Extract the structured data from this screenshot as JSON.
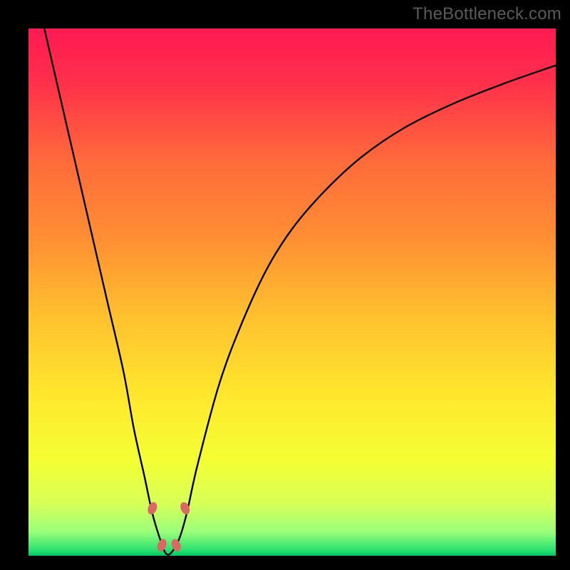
{
  "watermark": "TheBottleneck.com",
  "chart_data": {
    "type": "line",
    "title": "",
    "xlabel": "",
    "ylabel": "",
    "xlim": [
      0,
      100
    ],
    "ylim": [
      0,
      100
    ],
    "grid": false,
    "series": [
      {
        "name": "bottleneck-curve",
        "x": [
          3,
          6,
          9,
          12,
          15,
          18,
          20,
          22,
          23.5,
          25,
          26,
          27,
          28.5,
          30,
          32,
          36,
          40,
          45,
          50,
          56,
          63,
          71,
          80,
          90,
          100
        ],
        "y": [
          100,
          87,
          74,
          61,
          48,
          35,
          24,
          15,
          8,
          3,
          0.5,
          0.5,
          3,
          8,
          17,
          32,
          43,
          54,
          62,
          69,
          75.5,
          81,
          85.5,
          89.5,
          93
        ]
      }
    ],
    "markers": [
      {
        "name": "left-high",
        "x": 23.5,
        "y": 9
      },
      {
        "name": "left-low",
        "x": 25.3,
        "y": 2
      },
      {
        "name": "right-low",
        "x": 28.0,
        "y": 2
      },
      {
        "name": "right-high",
        "x": 29.7,
        "y": 9
      }
    ],
    "gradient_stops": [
      {
        "offset": 0.0,
        "color": "#ff1a53"
      },
      {
        "offset": 0.1,
        "color": "#ff2f4b"
      },
      {
        "offset": 0.25,
        "color": "#ff6a3a"
      },
      {
        "offset": 0.4,
        "color": "#ff8f33"
      },
      {
        "offset": 0.55,
        "color": "#ffc22e"
      },
      {
        "offset": 0.7,
        "color": "#ffe82e"
      },
      {
        "offset": 0.82,
        "color": "#f3ff33"
      },
      {
        "offset": 0.9,
        "color": "#d8ff57"
      },
      {
        "offset": 0.955,
        "color": "#9aff7a"
      },
      {
        "offset": 0.99,
        "color": "#28e06f"
      },
      {
        "offset": 1.0,
        "color": "#00c864"
      }
    ],
    "marker_style": {
      "fill": "#d86a63",
      "rx": 6,
      "ry": 9,
      "rotation_deg": 22
    }
  }
}
